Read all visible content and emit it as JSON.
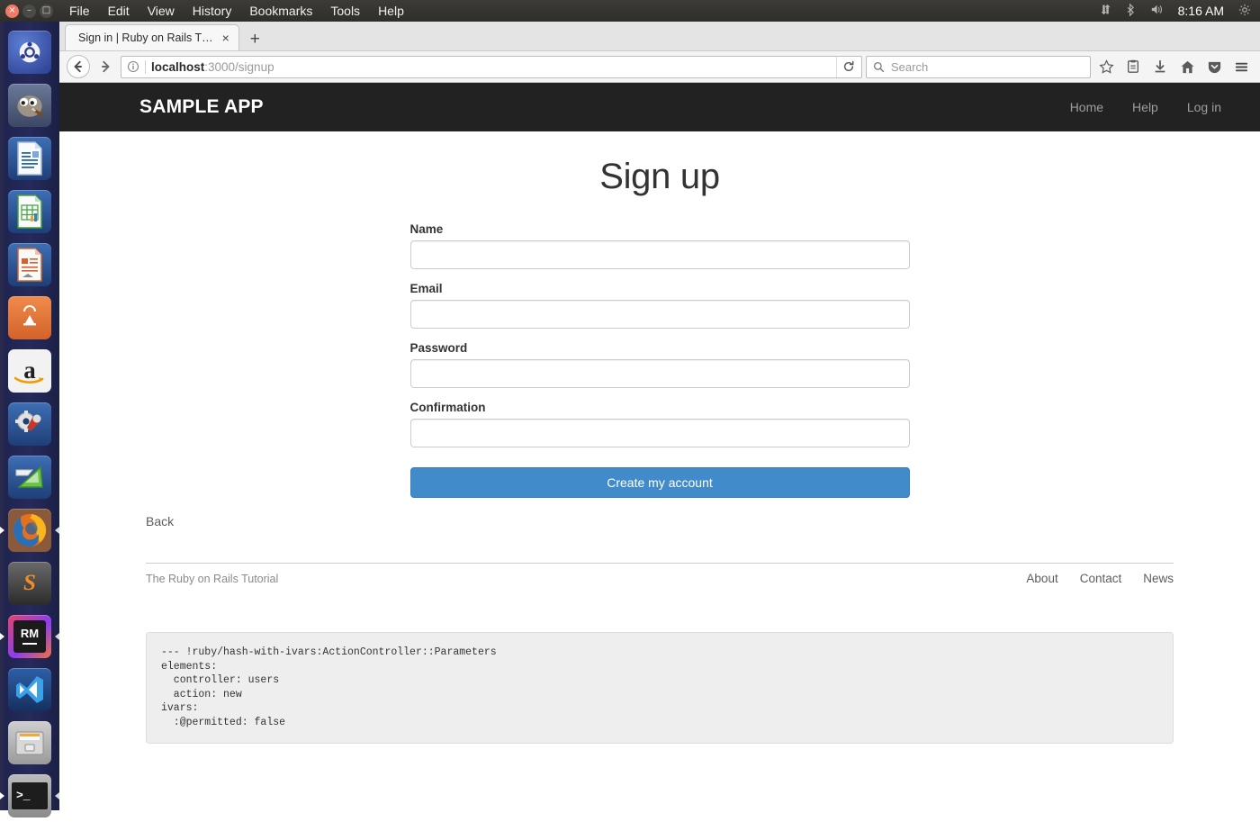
{
  "desktop": {
    "menus": [
      "File",
      "Edit",
      "View",
      "History",
      "Bookmarks",
      "Tools",
      "Help"
    ],
    "window_controls": {
      "close": "×",
      "minimize": "–",
      "maximize": "□"
    },
    "indicators": [
      "network-icon",
      "bluetooth-icon",
      "volume-icon"
    ],
    "clock": "8:16 AM",
    "session_icon": "gear-icon",
    "launcher": [
      {
        "name": "ubuntu-dash",
        "label": "",
        "active": false
      },
      {
        "name": "gimp",
        "label": "",
        "active": false
      },
      {
        "name": "libreoffice-writer",
        "label": "",
        "active": false
      },
      {
        "name": "libreoffice-calc",
        "label": "",
        "active": false
      },
      {
        "name": "libreoffice-impress",
        "label": "",
        "active": false
      },
      {
        "name": "ubuntu-software",
        "label": "A",
        "active": false
      },
      {
        "name": "amazon",
        "label": "a",
        "active": false
      },
      {
        "name": "system-settings",
        "label": "",
        "active": false
      },
      {
        "name": "ubuntu-help",
        "label": "",
        "active": false
      },
      {
        "name": "firefox",
        "label": "",
        "active": true
      },
      {
        "name": "sublime-text",
        "label": "S",
        "active": false
      },
      {
        "name": "rubymine",
        "label": "RM",
        "active": true
      },
      {
        "name": "visual-studio",
        "label": "",
        "active": false
      },
      {
        "name": "files",
        "label": "",
        "active": false
      },
      {
        "name": "terminal",
        "label": ">_",
        "active": true
      }
    ]
  },
  "browser": {
    "tab": {
      "title": "Sign in | Ruby on Rails T…",
      "close_glyph": "×"
    },
    "new_tab_glyph": "+",
    "back_glyph": "←",
    "forward_glyph": "→",
    "identity_glyph": "ⓘ",
    "url": {
      "host": "localhost",
      "path": ":3000/signup"
    },
    "reload_glyph": "↻",
    "search": {
      "placeholder": "Search",
      "icon": "search-icon"
    },
    "toolbar_icons": [
      "bookmark-star-icon",
      "library-icon",
      "downloads-icon",
      "home-icon",
      "pocket-icon",
      "menu-hamburger-icon"
    ]
  },
  "app": {
    "brand": "SAMPLE APP",
    "nav_links": [
      "Home",
      "Help",
      "Log in"
    ],
    "page_title": "Sign up",
    "form": {
      "fields": [
        {
          "label": "Name",
          "value": "",
          "placeholder": "",
          "type": "text",
          "name": "name-field"
        },
        {
          "label": "Email",
          "value": "",
          "placeholder": "",
          "type": "text",
          "name": "email-field"
        },
        {
          "label": "Password",
          "value": "",
          "placeholder": "",
          "type": "password",
          "name": "password-field"
        },
        {
          "label": "Confirmation",
          "value": "",
          "placeholder": "",
          "type": "password",
          "name": "confirmation-field"
        }
      ],
      "submit_label": "Create my account"
    },
    "back_link": "Back",
    "footer": {
      "credit": "The Ruby on Rails Tutorial",
      "links": [
        "About",
        "Contact",
        "News"
      ]
    },
    "debug": "--- !ruby/hash-with-ivars:ActionController::Parameters\nelements:\n  controller: users\n  action: new\nivars:\n  :@permitted: false"
  },
  "colors": {
    "navbar_bg": "#222222",
    "primary_button": "#428bca",
    "panel_bg": "#3c3b37",
    "launcher_bg": "#20265a",
    "debug_bg": "#eeeeee"
  }
}
